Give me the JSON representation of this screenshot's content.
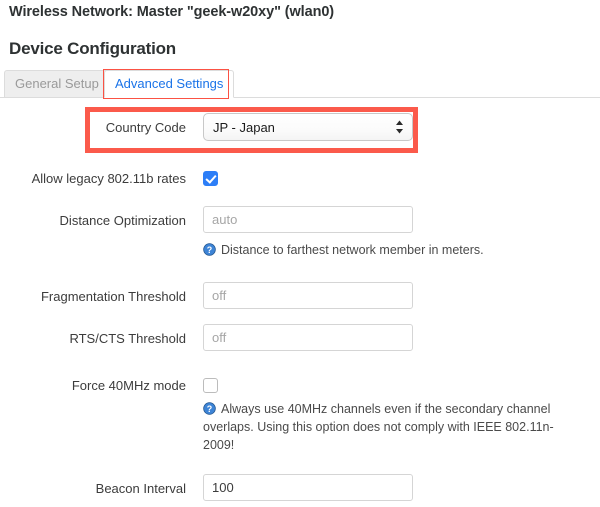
{
  "header": {
    "network_title": "Wireless Network: Master \"geek-w20xy\" (wlan0)",
    "section_title": "Device Configuration"
  },
  "tabs": [
    {
      "label": "General Setup",
      "active": false
    },
    {
      "label": "Advanced Settings",
      "active": true
    }
  ],
  "colors": {
    "highlight_red": "#fb5a4b",
    "tab_active_text": "#1a73e8",
    "checkbox_on": "#2d7ef7",
    "help_icon": "#3d84d6",
    "placeholder": "#a6a6a6",
    "border": "#d5d5d5"
  },
  "fields": {
    "country_code": {
      "label": "Country Code",
      "value": "JP - Japan",
      "options": [
        "JP - Japan"
      ],
      "highlighted": true
    },
    "legacy_rates": {
      "label": "Allow legacy 802.11b rates",
      "checked": true
    },
    "distance_optimization": {
      "label": "Distance Optimization",
      "value": "",
      "placeholder": "auto",
      "hint": "Distance to farthest network member in meters.",
      "hint_icon": "help-circle-icon"
    },
    "fragmentation_threshold": {
      "label": "Fragmentation Threshold",
      "value": "",
      "placeholder": "off"
    },
    "rts_cts_threshold": {
      "label": "RTS/CTS Threshold",
      "value": "",
      "placeholder": "off"
    },
    "force_40mhz": {
      "label": "Force 40MHz mode",
      "checked": false,
      "hint": "Always use 40MHz channels even if the secondary channel overlaps. Using this option does not comply with IEEE 802.11n-2009!",
      "hint_icon": "help-circle-icon"
    },
    "beacon_interval": {
      "label": "Beacon Interval",
      "value": "100",
      "placeholder": ""
    }
  }
}
